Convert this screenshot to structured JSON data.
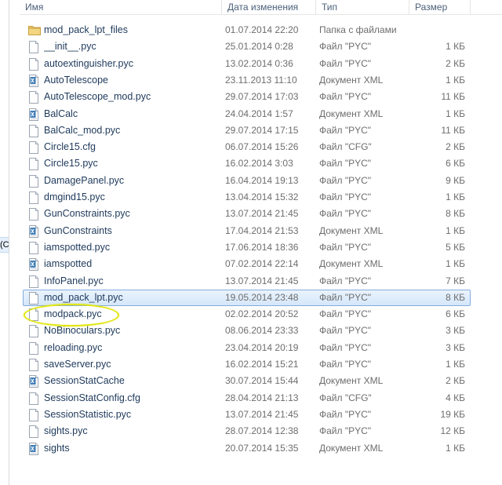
{
  "left_strip_label": "(C:",
  "columns": {
    "name": "Имя",
    "date": "Дата изменения",
    "type": "Тип",
    "size": "Размер"
  },
  "icons": {
    "folder": "folder-icon",
    "file": "file-icon",
    "xml": "xml-file-icon"
  },
  "colors": {
    "selection_bg": "#d5e7fb",
    "selection_border": "#84acdd",
    "annotation": "#e2e60e",
    "folder": "#e8c46a"
  },
  "files": [
    {
      "name": "mod_pack_lpt_files",
      "date": "01.07.2014 22:20",
      "type": "Папка с файлами",
      "size": "",
      "icon": "folder"
    },
    {
      "name": "__init__.pyc",
      "date": "25.01.2014 0:28",
      "type": "Файл \"PYC\"",
      "size": "1 КБ",
      "icon": "file"
    },
    {
      "name": "autoextinguisher.pyc",
      "date": "13.02.2014 0:36",
      "type": "Файл \"PYC\"",
      "size": "2 КБ",
      "icon": "file"
    },
    {
      "name": "AutoTelescope",
      "date": "23.11.2013 11:10",
      "type": "Документ XML",
      "size": "1 КБ",
      "icon": "xml"
    },
    {
      "name": "AutoTelescope_mod.pyc",
      "date": "29.07.2014 17:03",
      "type": "Файл \"PYC\"",
      "size": "11 КБ",
      "icon": "file"
    },
    {
      "name": "BalCalc",
      "date": "24.04.2014 1:57",
      "type": "Документ XML",
      "size": "1 КБ",
      "icon": "xml"
    },
    {
      "name": "BalCalc_mod.pyc",
      "date": "29.07.2014 17:15",
      "type": "Файл \"PYC\"",
      "size": "11 КБ",
      "icon": "file"
    },
    {
      "name": "Circle15.cfg",
      "date": "06.07.2014 15:26",
      "type": "Файл \"CFG\"",
      "size": "2 КБ",
      "icon": "file"
    },
    {
      "name": "Circle15.pyc",
      "date": "16.02.2014 3:03",
      "type": "Файл \"PYC\"",
      "size": "6 КБ",
      "icon": "file"
    },
    {
      "name": "DamagePanel.pyc",
      "date": "16.04.2014 19:13",
      "type": "Файл \"PYC\"",
      "size": "9 КБ",
      "icon": "file"
    },
    {
      "name": "dmgind15.pyc",
      "date": "13.04.2014 15:32",
      "type": "Файл \"PYC\"",
      "size": "1 КБ",
      "icon": "file"
    },
    {
      "name": "GunConstraints.pyc",
      "date": "13.07.2014 21:45",
      "type": "Файл \"PYC\"",
      "size": "8 КБ",
      "icon": "file"
    },
    {
      "name": "GunConstraints",
      "date": "17.04.2014 21:53",
      "type": "Документ XML",
      "size": "1 КБ",
      "icon": "xml"
    },
    {
      "name": "iamspotted.pyc",
      "date": "17.06.2014 18:36",
      "type": "Файл \"PYC\"",
      "size": "5 КБ",
      "icon": "file"
    },
    {
      "name": "iamspotted",
      "date": "07.02.2014 22:14",
      "type": "Документ XML",
      "size": "1 КБ",
      "icon": "xml"
    },
    {
      "name": "InfoPanel.pyc",
      "date": "13.07.2014 21:45",
      "type": "Файл \"PYC\"",
      "size": "7 КБ",
      "icon": "file"
    },
    {
      "name": "mod_pack_lpt.pyc",
      "date": "19.05.2014 23:48",
      "type": "Файл \"PYC\"",
      "size": "8 КБ",
      "icon": "file",
      "selected": true
    },
    {
      "name": "modpack.pyc",
      "date": "02.02.2014 20:52",
      "type": "Файл \"PYC\"",
      "size": "6 КБ",
      "icon": "file"
    },
    {
      "name": "NoBinoculars.pyc",
      "date": "08.06.2014 23:33",
      "type": "Файл \"PYC\"",
      "size": "3 КБ",
      "icon": "file"
    },
    {
      "name": "reloading.pyc",
      "date": "23.04.2014 20:19",
      "type": "Файл \"PYC\"",
      "size": "3 КБ",
      "icon": "file"
    },
    {
      "name": "saveServer.pyc",
      "date": "16.02.2014 15:21",
      "type": "Файл \"PYC\"",
      "size": "1 КБ",
      "icon": "file"
    },
    {
      "name": "SessionStatCache",
      "date": "30.07.2014 15:44",
      "type": "Документ XML",
      "size": "2 КБ",
      "icon": "xml"
    },
    {
      "name": "SessionStatConfig.cfg",
      "date": "28.04.2014 21:13",
      "type": "Файл \"CFG\"",
      "size": "4 КБ",
      "icon": "file"
    },
    {
      "name": "SessionStatistic.pyc",
      "date": "13.07.2014 21:45",
      "type": "Файл \"PYC\"",
      "size": "19 КБ",
      "icon": "file"
    },
    {
      "name": "sights.pyc",
      "date": "28.07.2014 12:38",
      "type": "Файл \"PYC\"",
      "size": "12 КБ",
      "icon": "file"
    },
    {
      "name": "sights",
      "date": "20.07.2014 15:35",
      "type": "Документ XML",
      "size": "1 КБ",
      "icon": "xml"
    }
  ]
}
